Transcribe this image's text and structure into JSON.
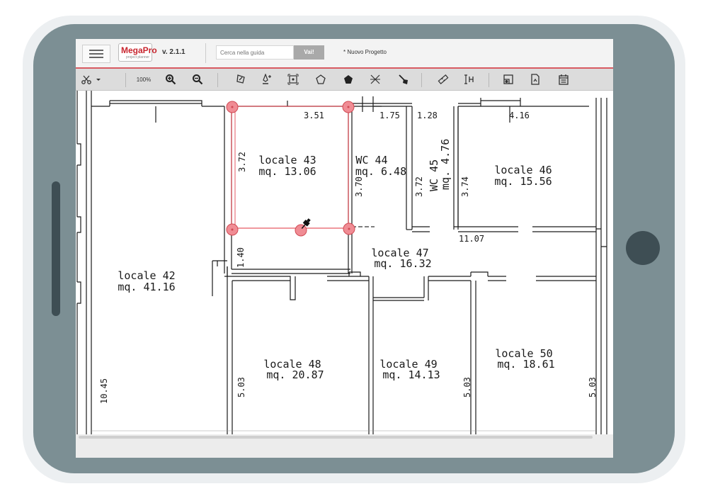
{
  "app": {
    "logo": "MegaPro",
    "logo_subtitle": "project planner",
    "version": "v. 2.1.1",
    "search_placeholder": "Cerca nella guida",
    "search_button": "Vai!",
    "project_name": "* Nuovo Progetto"
  },
  "toolbar": {
    "zoom_level": "100%",
    "icons": [
      "scissors-icon",
      "dropdown-arrow-icon",
      "zoom-in-icon",
      "zoom-out-icon",
      "polygon-draw-icon",
      "pen-add-icon",
      "frame-icon",
      "pentagon-outline-icon",
      "pentagon-filled-icon",
      "cross-lines-icon",
      "brush-icon",
      "ruler-icon",
      "height-icon",
      "image-layer-icon",
      "document-icon",
      "calendar-icon"
    ]
  },
  "plan": {
    "rooms": [
      {
        "name": "locale 42",
        "area": "mq. 41.16"
      },
      {
        "name": "locale 43",
        "area": "mq. 13.06"
      },
      {
        "name": "WC 44",
        "area": "mq. 6.48"
      },
      {
        "name": "WC 45",
        "area": "mq. 4.76"
      },
      {
        "name": "locale 46",
        "area": "mq. 15.56"
      },
      {
        "name": "locale 47",
        "area": "mq. 16.32"
      },
      {
        "name": "locale 48",
        "area": "mq. 20.87"
      },
      {
        "name": "locale 49",
        "area": "mq. 14.13"
      },
      {
        "name": "locale 50",
        "area": "mq. 18.61"
      }
    ],
    "dimensions": [
      "3.51",
      "1.75",
      "1.28",
      "4.16",
      "3.72",
      "3.70",
      "3.72",
      "3.74",
      "11.07",
      "1.40",
      "10.45",
      "5.03",
      "5.03",
      "5.03"
    ]
  },
  "colors": {
    "accent": "#d85a62",
    "selection": "#e0303c",
    "handle_fill": "#f08c94",
    "wall": "#1a1a1a",
    "tablet_frame": "#7c8f94"
  }
}
